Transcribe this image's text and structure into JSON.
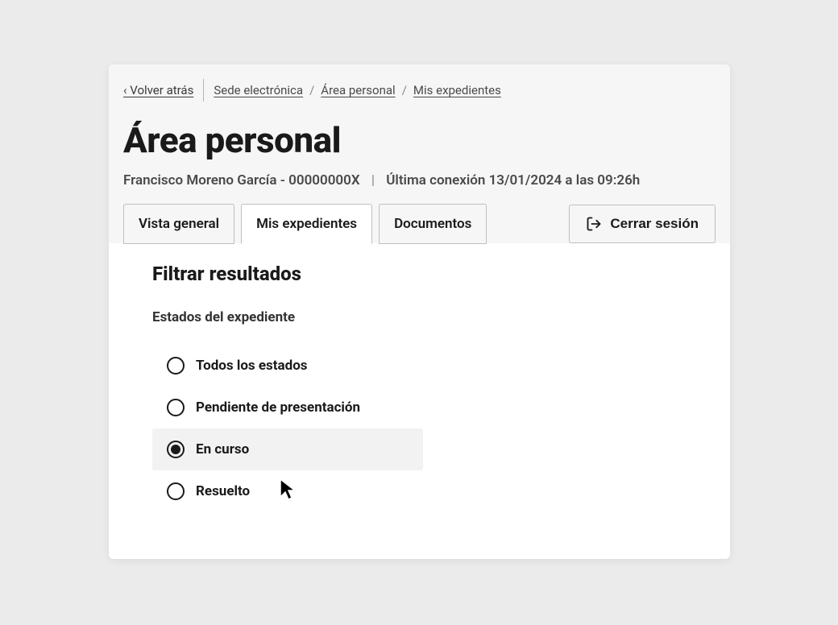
{
  "breadcrumb": {
    "back": "‹ Volver atrás",
    "items": [
      "Sede electrónica",
      "Área personal",
      "Mis expedientes"
    ]
  },
  "page_title": "Área personal",
  "user_info": {
    "name_id": "Francisco Moreno García - 00000000X",
    "last_login": "Última conexión 13/01/2024 a las 09:26h"
  },
  "tabs": {
    "overview": "Vista general",
    "dossiers": "Mis expedientes",
    "documents": "Documentos"
  },
  "logout_label": "Cerrar sesión",
  "filter": {
    "title": "Filtrar resultados",
    "subtitle": "Estados del expediente",
    "options": {
      "all": "Todos los estados",
      "pending": "Pendiente de presentación",
      "in_progress": "En curso",
      "resolved": "Resuelto"
    }
  }
}
